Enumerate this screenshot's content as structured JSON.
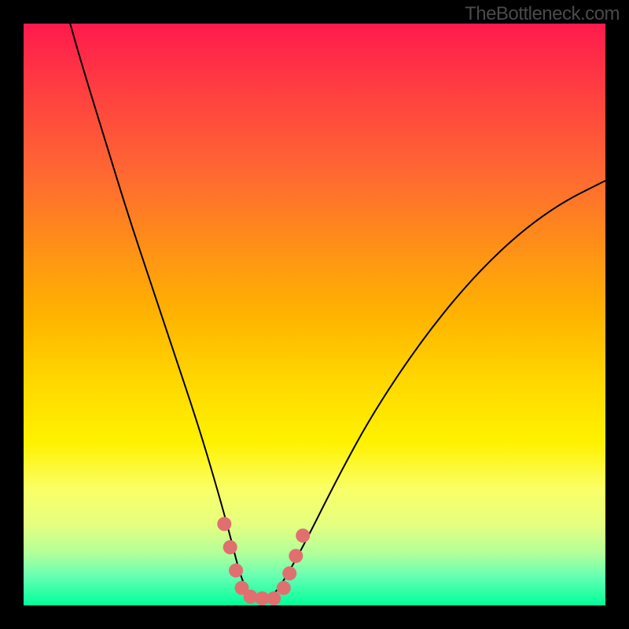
{
  "watermark": "TheBottleneck.com",
  "chart_data": {
    "type": "line",
    "title": "",
    "xlabel": "",
    "ylabel": "",
    "xlim": [
      0,
      100
    ],
    "ylim": [
      0,
      100
    ],
    "background": {
      "type": "vertical-gradient",
      "stops": [
        {
          "pos": 0,
          "color": "#ff1a4d"
        },
        {
          "pos": 50,
          "color": "#ffb300"
        },
        {
          "pos": 80,
          "color": "#faff66"
        },
        {
          "pos": 100,
          "color": "#00ff99"
        }
      ]
    },
    "series": [
      {
        "name": "bottleneck-curve",
        "x": [
          8,
          10,
          14,
          18,
          22,
          26,
          30,
          33,
          35.5,
          37,
          38.5,
          40,
          42,
          44,
          48,
          54,
          60,
          68,
          76,
          84,
          92,
          100
        ],
        "y": [
          100,
          93,
          80,
          67,
          55,
          43,
          31,
          21,
          12,
          6,
          2,
          1,
          1,
          3,
          10,
          22,
          33,
          45,
          55,
          63,
          69,
          73
        ]
      }
    ],
    "annotations": {
      "valley_markers": {
        "color": "#e07070",
        "points": [
          {
            "x": 34.5,
            "y": 14
          },
          {
            "x": 35.5,
            "y": 10
          },
          {
            "x": 36.5,
            "y": 6
          },
          {
            "x": 37.5,
            "y": 3
          },
          {
            "x": 39,
            "y": 1.5
          },
          {
            "x": 41,
            "y": 1.2
          },
          {
            "x": 43,
            "y": 1.2
          },
          {
            "x": 44.7,
            "y": 3
          },
          {
            "x": 45.7,
            "y": 5.5
          },
          {
            "x": 46.8,
            "y": 8.5
          },
          {
            "x": 48,
            "y": 12
          }
        ]
      }
    }
  }
}
